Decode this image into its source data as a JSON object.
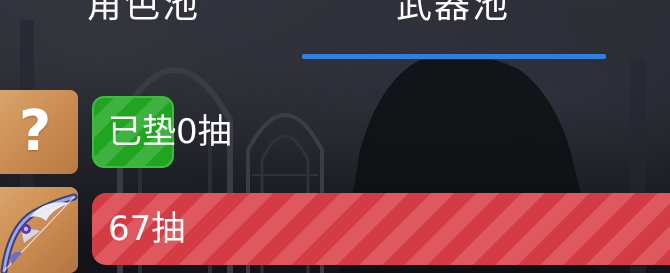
{
  "tabs": [
    {
      "label": "角色池",
      "active": false
    },
    {
      "label": "武器池",
      "active": true
    }
  ],
  "accent_color": "#2f7fe0",
  "rows": [
    {
      "icon": "question-mark-icon",
      "icon_glyph": "?",
      "badge_color": "#1fa51f",
      "text": "已垫0抽"
    },
    {
      "icon": "bow-weapon-icon",
      "bar_color": "#d33c44",
      "text": "67抽"
    }
  ]
}
